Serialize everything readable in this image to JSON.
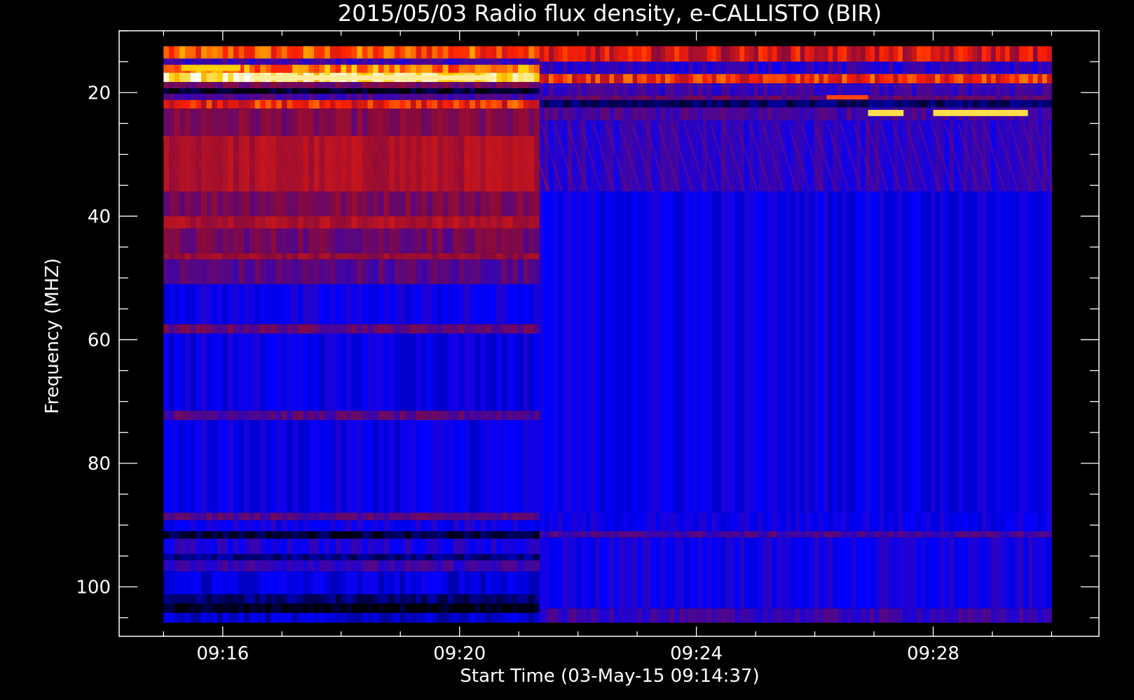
{
  "chart_data": {
    "type": "heatmap",
    "title": "2015/05/03  Radio flux density, e-CALLISTO (BIR)",
    "xlabel": "Start Time (03-May-15 09:14:37)",
    "ylabel": "Frequency (MHZ)",
    "x_ticks": [
      "09:16",
      "09:20",
      "09:24",
      "09:28"
    ],
    "x_tick_minutes": [
      16,
      20,
      24,
      28
    ],
    "x_range_minutes": [
      14.25,
      30.8
    ],
    "data_time_range_minutes": [
      15.0,
      30.0
    ],
    "y_ticks": [
      "20",
      "40",
      "60",
      "80",
      "100"
    ],
    "y_tick_values": [
      20,
      40,
      60,
      80,
      100
    ],
    "y_range_mhz": [
      10,
      108
    ],
    "data_freq_range_mhz": [
      12.5,
      105.8
    ],
    "y_inverted": true,
    "data_switch_minute": 21.35,
    "colormap": [
      "#000000",
      "#0000ff",
      "#8a0a3a",
      "#ff2000",
      "#ffd000",
      "#ffffff"
    ],
    "bands_before_switch": [
      {
        "f0": 12.5,
        "f1": 14.5,
        "level": 3.2
      },
      {
        "f0": 14.5,
        "f1": 15.5,
        "level": 1.4
      },
      {
        "f0": 15.5,
        "f1": 16.8,
        "level": 3.5
      },
      {
        "f0": 16.8,
        "f1": 18.3,
        "level": 4.4
      },
      {
        "f0": 18.3,
        "f1": 19.3,
        "level": 1.8
      },
      {
        "f0": 19.3,
        "f1": 20.2,
        "level": 0.2
      },
      {
        "f0": 20.2,
        "f1": 21.2,
        "level": 1.5
      },
      {
        "f0": 21.2,
        "f1": 22.6,
        "level": 2.9
      },
      {
        "f0": 22.6,
        "f1": 27.0,
        "level": 1.9
      },
      {
        "f0": 27.0,
        "f1": 36.0,
        "level": 2.3
      },
      {
        "f0": 36.0,
        "f1": 40.0,
        "level": 1.9
      },
      {
        "f0": 40.0,
        "f1": 42.0,
        "level": 2.3
      },
      {
        "f0": 42.0,
        "f1": 46.0,
        "level": 1.8
      },
      {
        "f0": 46.0,
        "f1": 47.0,
        "level": 2.1
      },
      {
        "f0": 47.0,
        "f1": 51.0,
        "level": 1.6
      },
      {
        "f0": 51.0,
        "f1": 57.5,
        "level": 1.05
      },
      {
        "f0": 57.5,
        "f1": 59.0,
        "level": 1.7
      },
      {
        "f0": 59.0,
        "f1": 71.5,
        "level": 1.0
      },
      {
        "f0": 71.5,
        "f1": 73.0,
        "level": 1.6
      },
      {
        "f0": 73.0,
        "f1": 88.0,
        "level": 1.0
      },
      {
        "f0": 88.0,
        "f1": 89.2,
        "level": 1.6
      },
      {
        "f0": 89.2,
        "f1": 91.0,
        "level": 1.1
      },
      {
        "f0": 91.0,
        "f1": 92.2,
        "level": 0.25
      },
      {
        "f0": 92.2,
        "f1": 94.7,
        "level": 1.2
      },
      {
        "f0": 94.7,
        "f1": 95.7,
        "level": 0.5
      },
      {
        "f0": 95.7,
        "f1": 97.5,
        "level": 1.4
      },
      {
        "f0": 97.5,
        "f1": 101.2,
        "level": 0.9
      },
      {
        "f0": 101.2,
        "f1": 102.7,
        "level": 0.45
      },
      {
        "f0": 102.7,
        "f1": 104.2,
        "level": 0.1
      },
      {
        "f0": 104.2,
        "f1": 105.8,
        "level": 0.8
      }
    ],
    "bands_after_switch": [
      {
        "f0": 12.5,
        "f1": 15.0,
        "level": 2.6
      },
      {
        "f0": 15.0,
        "f1": 17.0,
        "level": 1.3
      },
      {
        "f0": 17.0,
        "f1": 18.5,
        "level": 2.9
      },
      {
        "f0": 18.5,
        "f1": 20.5,
        "level": 1.4
      },
      {
        "f0": 20.5,
        "f1": 21.2,
        "level": 1.7
      },
      {
        "f0": 21.2,
        "f1": 22.4,
        "level": 0.4
      },
      {
        "f0": 22.4,
        "f1": 24.5,
        "level": 1.5
      },
      {
        "f0": 24.5,
        "f1": 36.0,
        "level": 1.3
      },
      {
        "f0": 36.0,
        "f1": 88.0,
        "level": 1.0
      },
      {
        "f0": 88.0,
        "f1": 91.0,
        "level": 1.05
      },
      {
        "f0": 91.0,
        "f1": 92.0,
        "level": 1.5
      },
      {
        "f0": 92.0,
        "f1": 103.5,
        "level": 1.1
      },
      {
        "f0": 103.5,
        "f1": 105.8,
        "level": 1.4
      }
    ],
    "bright_features": [
      {
        "t0": 26.9,
        "t1": 27.5,
        "f0": 22.8,
        "f1": 23.8,
        "level": 4.3
      },
      {
        "t0": 28.0,
        "t1": 29.6,
        "f0": 22.8,
        "f1": 23.8,
        "level": 4.3
      },
      {
        "t0": 26.2,
        "t1": 26.9,
        "f0": 20.4,
        "f1": 21.1,
        "level": 3.2
      },
      {
        "t0": 15.3,
        "t1": 16.3,
        "f0": 15.5,
        "f1": 16.5,
        "level": 4.0
      },
      {
        "t0": 16.5,
        "t1": 20.6,
        "f0": 17.2,
        "f1": 18.0,
        "level": 4.6
      }
    ]
  }
}
